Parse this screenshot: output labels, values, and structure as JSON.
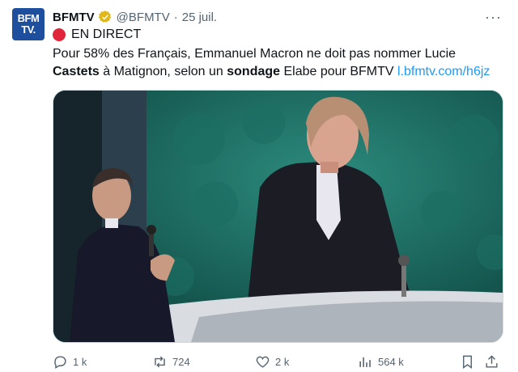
{
  "author": {
    "avatar_text_line1": "BFM",
    "avatar_text_line2": "TV.",
    "name": "BFMTV",
    "handle": "@BFMTV",
    "separator": "·",
    "date": "25 juil."
  },
  "tweet": {
    "live_label": "EN DIRECT",
    "text_part1": "Pour 58% des Français, Emmanuel Macron ne doit pas nommer Lucie ",
    "bold1": "Castets",
    "text_part2": " à Matignon, selon un ",
    "bold2": "sondage",
    "text_part3": " Elabe pour BFMTV ",
    "link": "l.bfmtv.com/h6jz"
  },
  "actions": {
    "replies": "1 k",
    "retweets": "724",
    "likes": "2 k",
    "views": "564 k"
  },
  "colors": {
    "brand": "#1d4f9e",
    "link": "#1d9bf0",
    "verified": "#e2b719",
    "live": "#e0243a",
    "muted": "#536471"
  },
  "icons": [
    "verified-badge-icon",
    "more-icon",
    "reply-icon",
    "retweet-icon",
    "like-icon",
    "views-icon",
    "bookmark-icon",
    "share-icon"
  ]
}
